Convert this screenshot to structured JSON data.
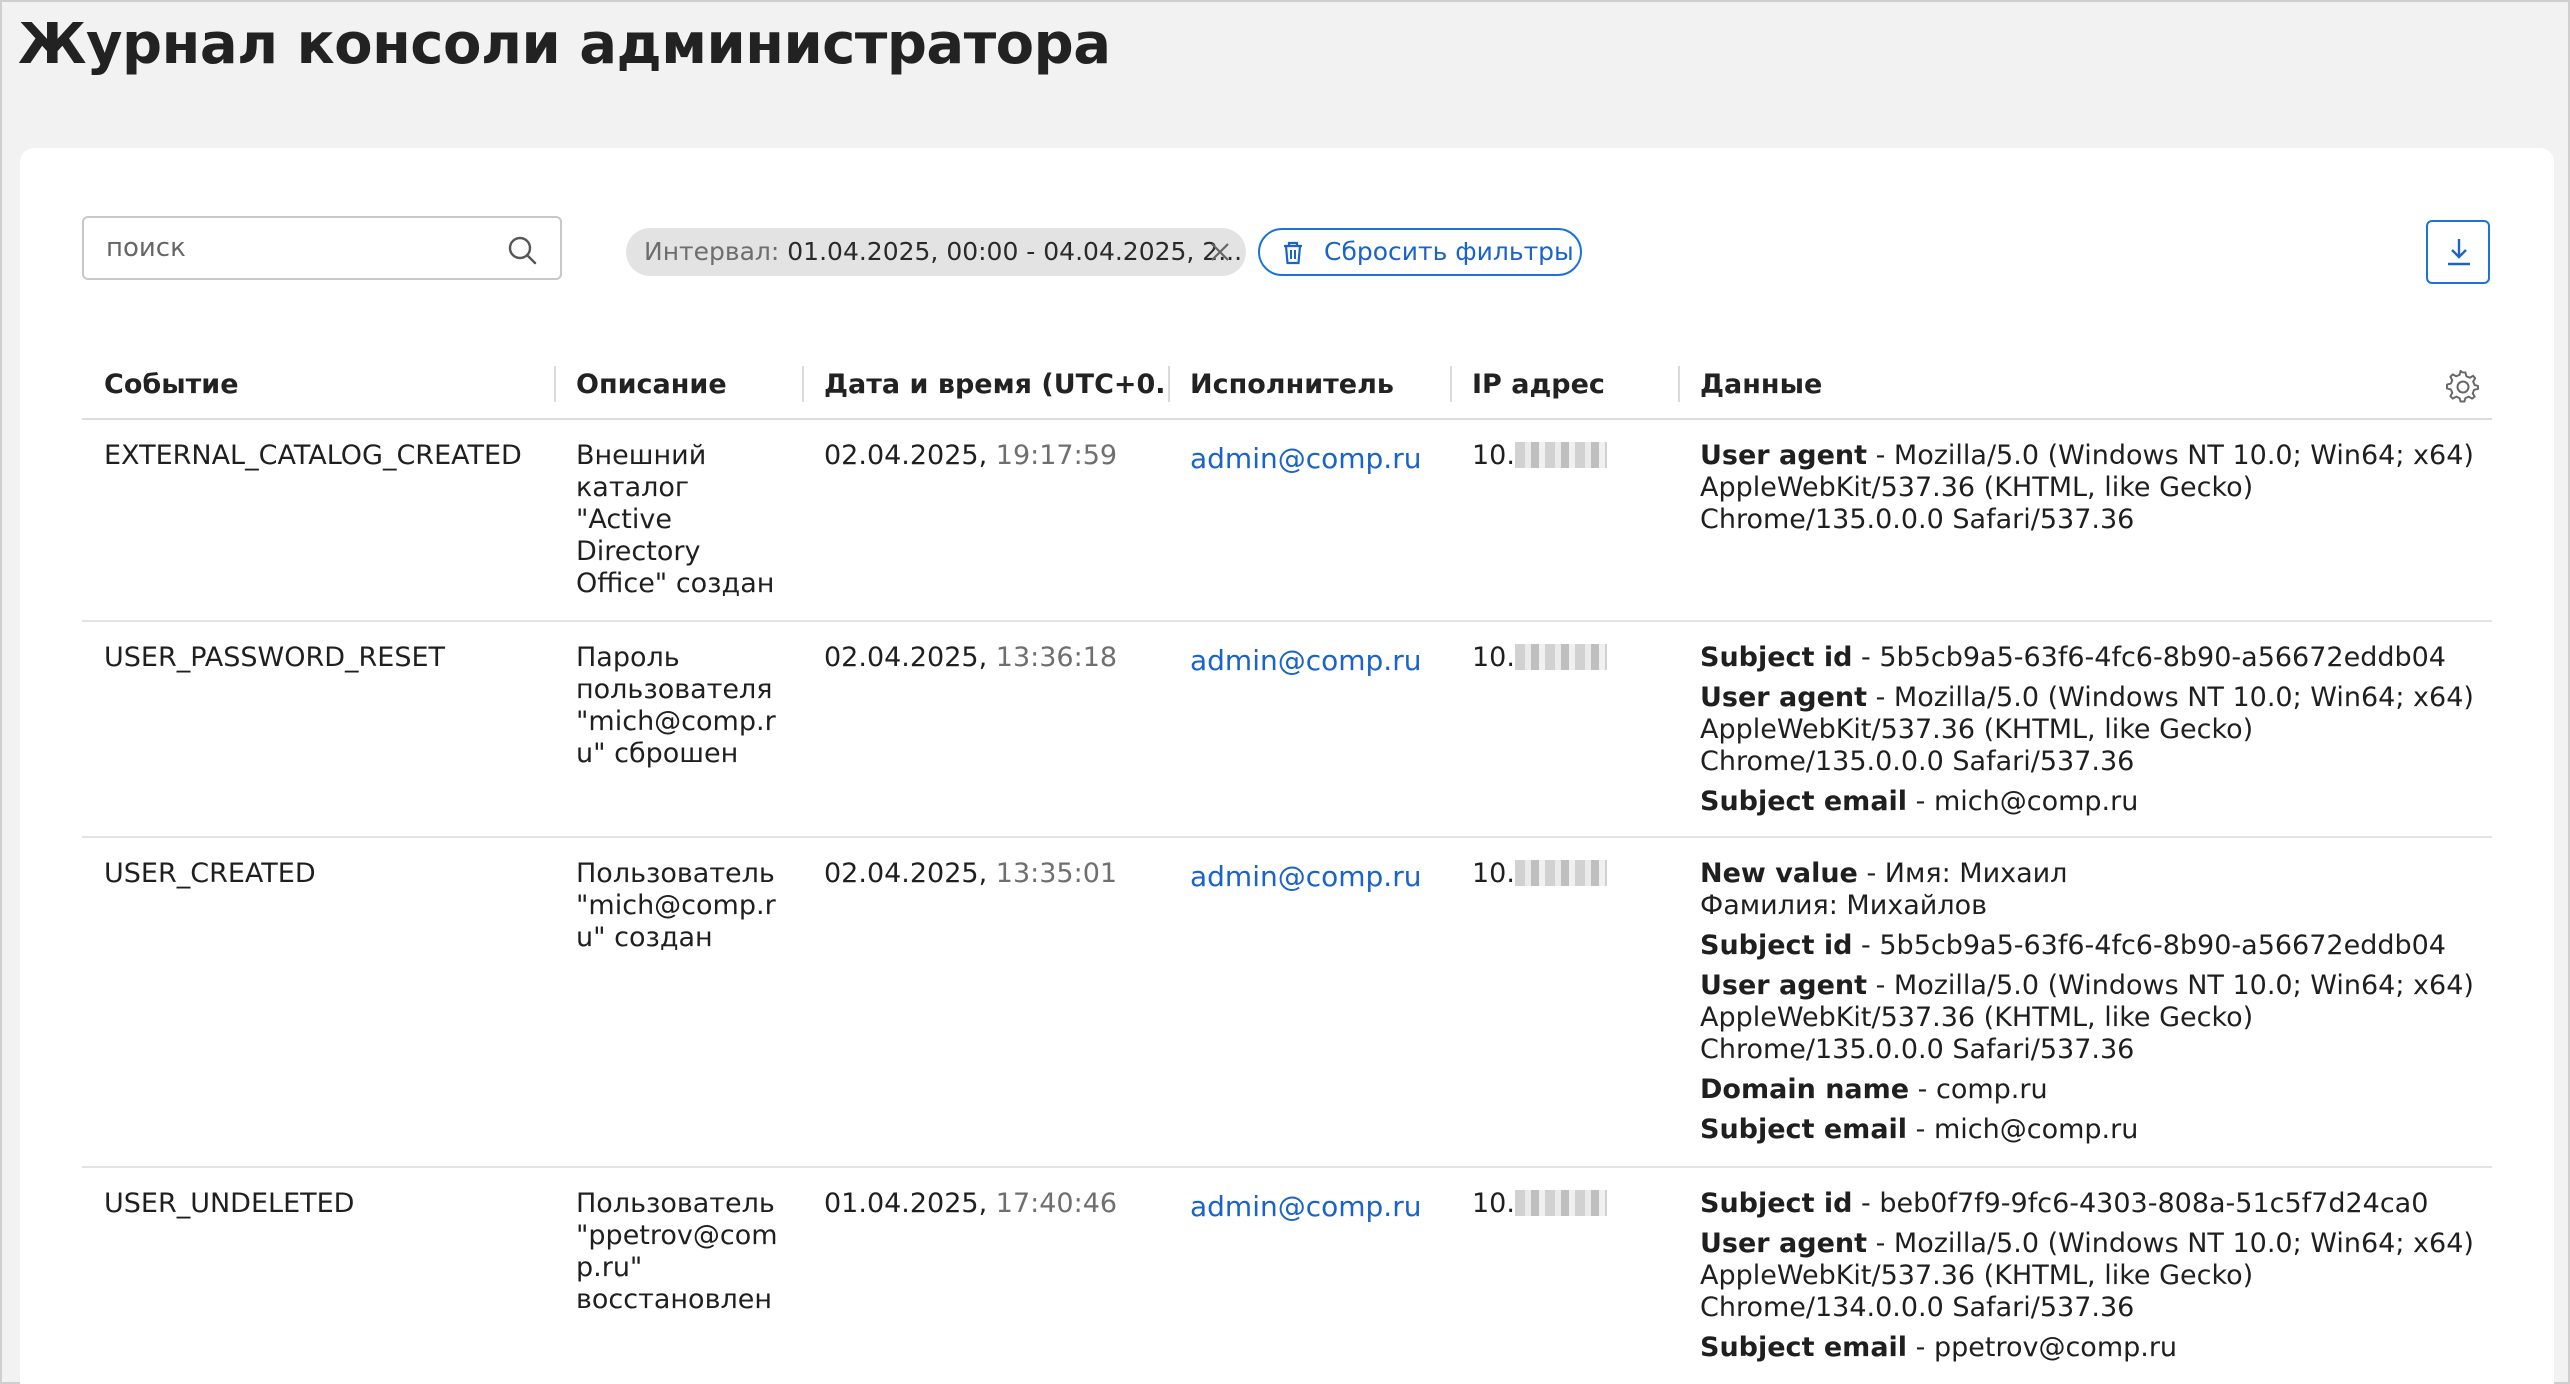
{
  "page": {
    "title": "Журнал консоли администратора"
  },
  "toolbar": {
    "search_placeholder": "поиск",
    "filter_chip": {
      "key": "Интервал:",
      "value": "01.04.2025, 00:00 - 04.04.2025, 2..."
    },
    "reset_label": "Сбросить фильтры"
  },
  "columns": {
    "event": "Событие",
    "description": "Описание",
    "datetime": "Дата и время (UTC+0...",
    "actor": "Исполнитель",
    "ip": "IP адрес",
    "data": "Данные"
  },
  "rows": [
    {
      "event": "EXTERNAL_CATALOG_CREATED",
      "description": "Внешний каталог \"Active Directory Office\" создан",
      "date": "02.04.2025,",
      "time": "19:17:59",
      "actor": "admin@comp.ru",
      "ip": "10.",
      "data": [
        {
          "key": "User agent",
          "value": " - Mozilla/5.0 (Windows NT 10.0; Win64; x64) AppleWebKit/537.36 (KHTML, like Gecko) Chrome/135.0.0.0 Safari/537.36"
        }
      ]
    },
    {
      "event": "USER_PASSWORD_RESET",
      "description": "Пароль пользователя \"mich@comp.ru\" сброшен",
      "date": "02.04.2025,",
      "time": "13:36:18",
      "actor": "admin@comp.ru",
      "ip": "10.",
      "data": [
        {
          "key": "Subject id",
          "value": " - 5b5cb9a5-63f6-4fc6-8b90-a56672eddb04"
        },
        {
          "key": "User agent",
          "value": " - Mozilla/5.0 (Windows NT 10.0; Win64; x64) AppleWebKit/537.36 (KHTML, like Gecko) Chrome/135.0.0.0 Safari/537.36"
        },
        {
          "key": "Subject email",
          "value": " - mich@comp.ru"
        }
      ]
    },
    {
      "event": "USER_CREATED",
      "description": "Пользователь \"mich@comp.ru\" создан",
      "date": "02.04.2025,",
      "time": "13:35:01",
      "actor": "admin@comp.ru",
      "ip": "10.",
      "data": [
        {
          "key": "New value",
          "value": " - Имя: Михаил Фамилия: Михайлов"
        },
        {
          "key": "Subject id",
          "value": " - 5b5cb9a5-63f6-4fc6-8b90-a56672eddb04"
        },
        {
          "key": "User agent",
          "value": " - Mozilla/5.0 (Windows NT 10.0; Win64; x64) AppleWebKit/537.36 (KHTML, like Gecko) Chrome/135.0.0.0 Safari/537.36"
        },
        {
          "key": "Domain name",
          "value": " - comp.ru"
        },
        {
          "key": "Subject email",
          "value": " - mich@comp.ru"
        }
      ]
    },
    {
      "event": "USER_UNDELETED",
      "description": "Пользователь \"ppetrov@comp.ru\" восстановлен",
      "date": "01.04.2025,",
      "time": "17:40:46",
      "actor": "admin@comp.ru",
      "ip": "10.",
      "data": [
        {
          "key": "Subject id",
          "value": " - beb0f7f9-9fc6-4303-808a-51c5f7d24ca0"
        },
        {
          "key": "User agent",
          "value": " - Mozilla/5.0 (Windows NT 10.0; Win64; x64) AppleWebKit/537.36 (KHTML, like Gecko) Chrome/134.0.0.0 Safari/537.36"
        },
        {
          "key": "Subject email",
          "value": " - ppetrov@comp.ru"
        }
      ]
    }
  ],
  "colors": {
    "accent": "#1a63c9",
    "muted_time": "#6f6f6f"
  },
  "icons": {
    "search": "search-icon",
    "close": "close-icon",
    "trash": "trash-icon",
    "download": "download-icon",
    "settings": "gear-icon"
  }
}
